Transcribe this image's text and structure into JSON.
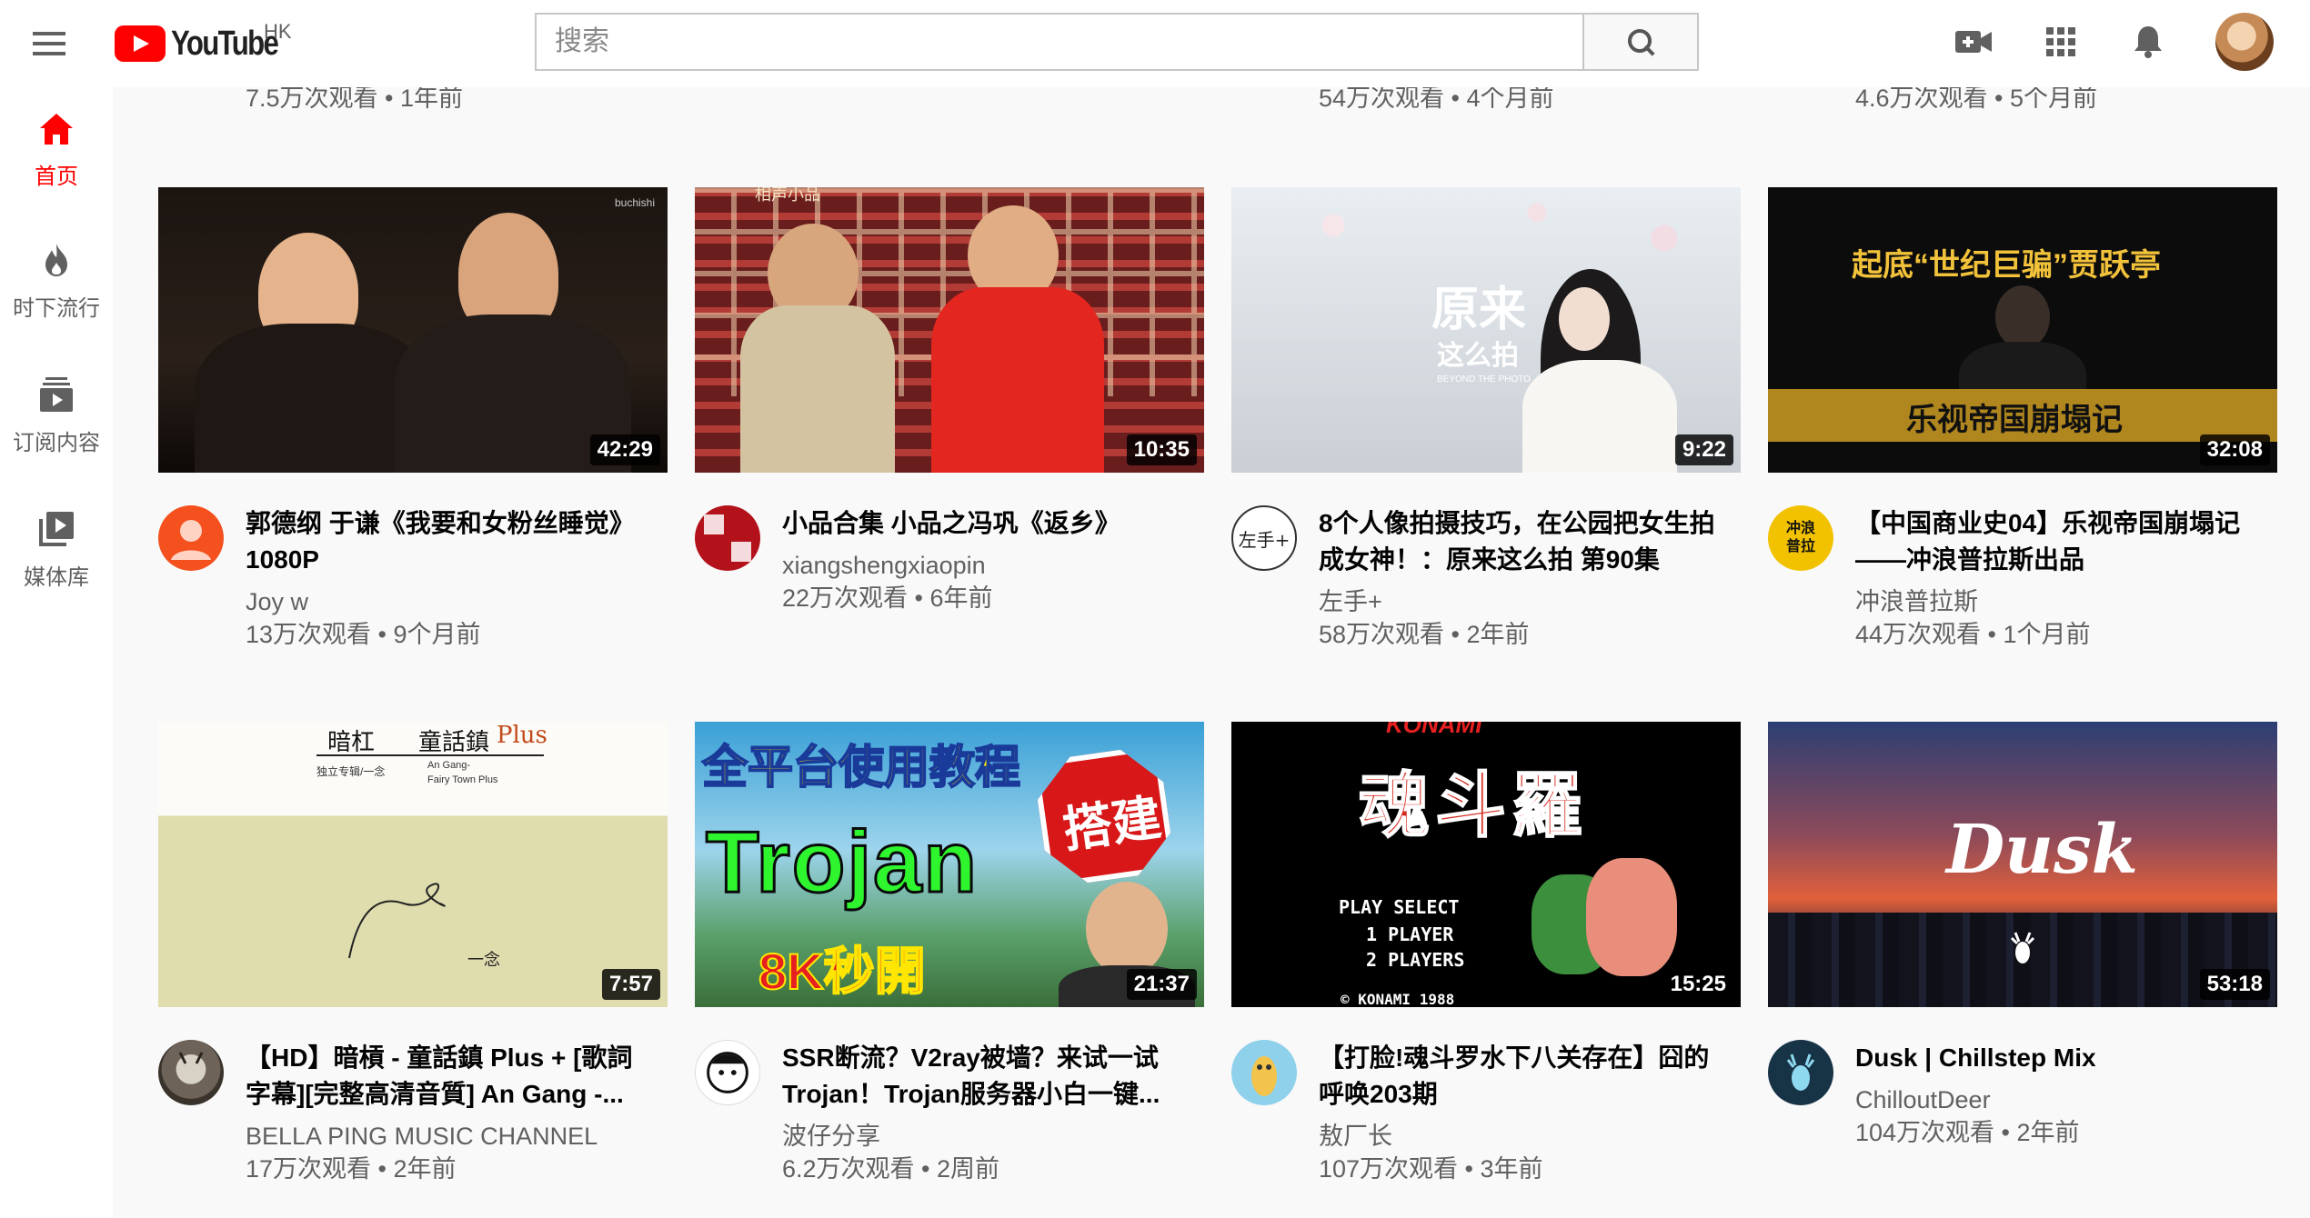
{
  "masthead": {
    "logo_text": "YouTube",
    "region": "HK",
    "search_placeholder": "搜索"
  },
  "sidebar": {
    "items": [
      {
        "label": "首页",
        "icon": "home-icon",
        "active": true
      },
      {
        "label": "时下流行",
        "icon": "trending-icon",
        "active": false
      },
      {
        "label": "订阅内容",
        "icon": "subscriptions-icon",
        "active": false
      },
      {
        "label": "媒体库",
        "icon": "library-icon",
        "active": false
      }
    ]
  },
  "partial_row": [
    "7.5万次观看 • 1年前",
    "54万次观看 • 4个月前",
    "4.6万次观看 • 5个月前"
  ],
  "videos": [
    {
      "title": "郭德纲 于谦《我要和女粉丝睡觉》1080P",
      "channel": "Joy w",
      "stats": "13万次观看 • 9个月前",
      "duration": "42:29"
    },
    {
      "title": "小品合集 小品之冯巩《返乡》",
      "channel": "xiangshengxiaopin",
      "stats": "22万次观看 • 6年前",
      "duration": "10:35"
    },
    {
      "title": "8个人像拍摄技巧，在公园把女生拍成女神！：原来这么拍 第90集",
      "channel": "左手+",
      "stats": "58万次观看 • 2年前",
      "duration": "9:22"
    },
    {
      "title": "【中国商业史04】乐视帝国崩塌记——冲浪普拉斯出品",
      "channel": "冲浪普拉斯",
      "stats": "44万次观看 • 1个月前",
      "duration": "32:08"
    },
    {
      "title": "【HD】暗槓 - 童話鎮 Plus + [歌詞字幕][完整高清音質] An Gang -...",
      "channel": "BELLA PING MUSIC CHANNEL",
      "stats": "17万次观看 • 2年前",
      "duration": "7:57"
    },
    {
      "title": "SSR断流？V2ray被墙？来试一试Trojan！Trojan服务器小白一键...",
      "channel": "波仔分享",
      "stats": "6.2万次观看 • 2周前",
      "duration": "21:37"
    },
    {
      "title": "【打脸!魂斗罗水下八关存在】囧的呼唤203期",
      "channel": "敖厂长",
      "stats": "107万次观看 • 3年前",
      "duration": "15:25"
    },
    {
      "title": "Dusk | Chillstep Mix",
      "channel": "ChilloutDeer",
      "stats": "104万次观看 • 2年前",
      "duration": "53:18"
    }
  ],
  "thumb_text": {
    "t2_logo": "相声小品",
    "t3_a": "原来",
    "t3_b": "这么拍",
    "t3_c": "BEYOND THE PHOTO",
    "t4_a": "起底“世纪巨骗”贾跃亭",
    "t4_b": "乐视帝国崩塌记",
    "t5_a": "暗杠",
    "t5_b": "童話鎮",
    "t5_c": "Plus",
    "t5_d": "独立专辑/一念",
    "t5_e": "An Gang-",
    "t5_f": "Fairy Town Plus",
    "t5_g": "一念",
    "t6_a": "全平台使用教程",
    "t6_b": "搭建",
    "t6_c": "Trojan",
    "t6_d": "8K秒開",
    "t7_a": "KONAMI",
    "t7_b": "魂斗羅",
    "t7_c": "PLAY SELECT",
    "t7_d": "1 PLAYER",
    "t7_e": "2 PLAYERS",
    "t7_f": "© KONAMI 1988",
    "t8_a": "Dusk",
    "t1_wm": "buchishi",
    "av3": "左手+",
    "av4": "冲浪普拉"
  }
}
